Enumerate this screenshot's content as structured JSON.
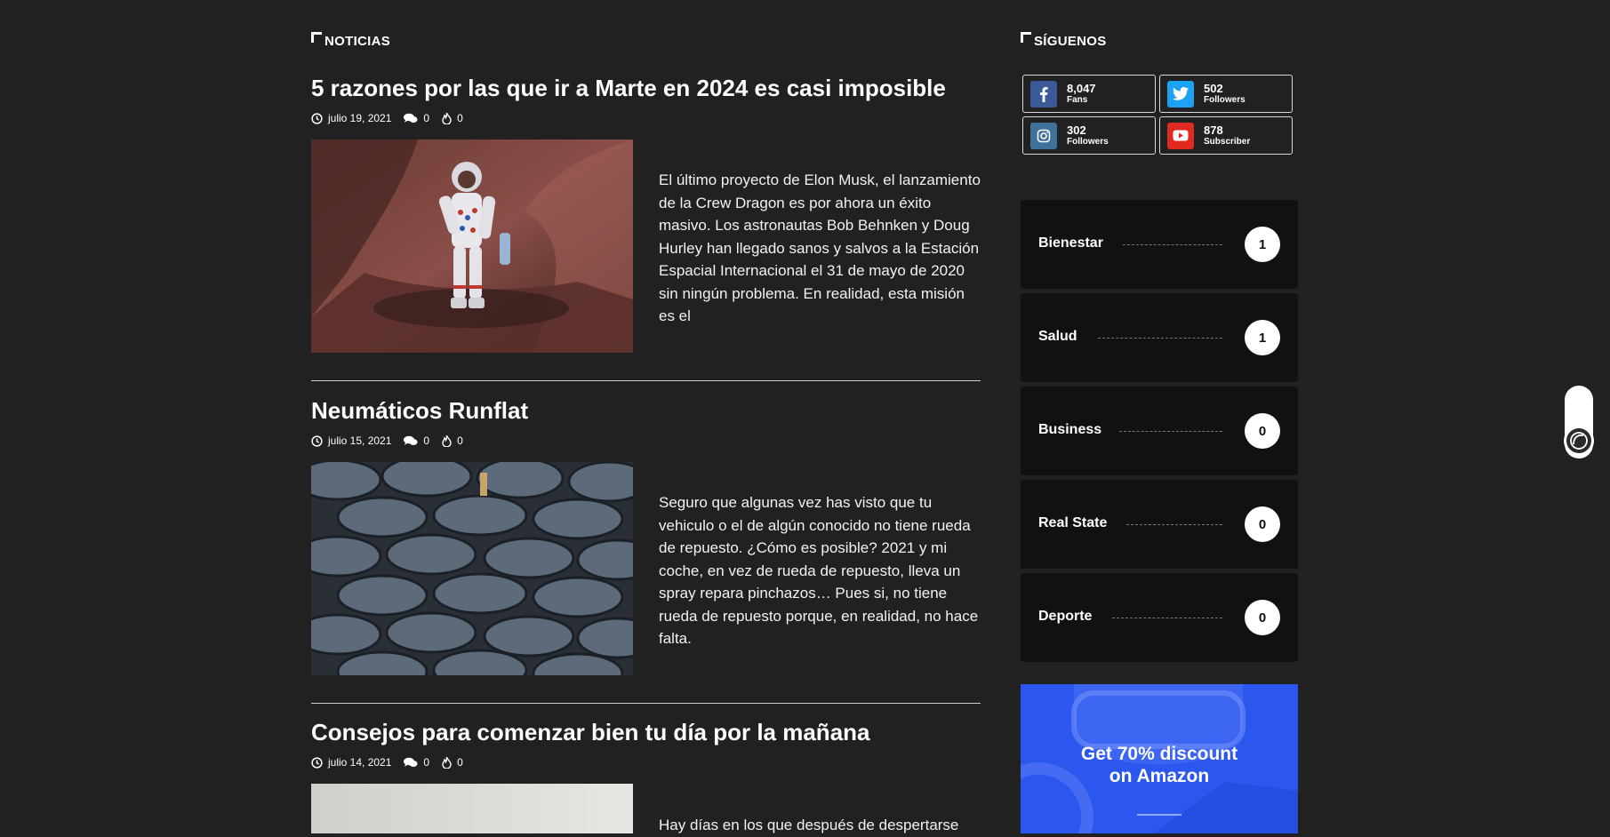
{
  "main": {
    "section_title": "NOTICIAS",
    "articles": [
      {
        "title": "5 razones por las que ir a Marte en 2024 es casi imposible",
        "date": "julio 19, 2021",
        "comments": "0",
        "views": "0",
        "excerpt": "El último proyecto de Elon Musk, el lanzamiento de la Crew Dragon es por ahora un éxito masivo. Los astronautas Bob Behnken y Doug Hurley han llegado sanos y salvos a la Estación Espacial Internacional el 31 de mayo de 2020 sin ningún problema. En realidad, esta misión es el"
      },
      {
        "title": "Neumáticos Runflat",
        "date": "julio 15, 2021",
        "comments": "0",
        "views": "0",
        "excerpt": "Seguro que algunas vez has visto que tu vehiculo o el de algún conocido no tiene rueda de repuesto. ¿Cómo es posible? 2021 y mi coche, en vez de rueda de repuesto, lleva un spray repara pinchazos… Pues si, no tiene rueda de repuesto porque, en realidad, no hace falta."
      },
      {
        "title": "Consejos para comenzar bien tu día por la mañana",
        "date": "julio 14, 2021",
        "comments": "0",
        "views": "0",
        "excerpt": "Hay días en los que después de despertarse"
      }
    ]
  },
  "sidebar": {
    "section_title": "SÍGUENOS",
    "social": [
      {
        "network": "facebook",
        "icon": "facebook-icon",
        "count": "8,047",
        "label": "Fans",
        "color": "#3b5998"
      },
      {
        "network": "twitter",
        "icon": "twitter-icon",
        "count": "502",
        "label": "Followers",
        "color": "#1da1f2"
      },
      {
        "network": "instagram",
        "icon": "instagram-icon",
        "count": "302",
        "label": "Followers",
        "color": "#3f729b"
      },
      {
        "network": "youtube",
        "icon": "youtube-icon",
        "count": "878",
        "label": "Subscriber",
        "color": "#e02a20"
      }
    ],
    "categories": [
      {
        "name": "Bienestar",
        "count": "1"
      },
      {
        "name": "Salud",
        "count": "1"
      },
      {
        "name": "Business",
        "count": "0"
      },
      {
        "name": "Real State",
        "count": "0"
      },
      {
        "name": "Deporte",
        "count": "0"
      }
    ],
    "promo": {
      "line1": "Get 70% discount",
      "line2": "on Amazon"
    }
  }
}
